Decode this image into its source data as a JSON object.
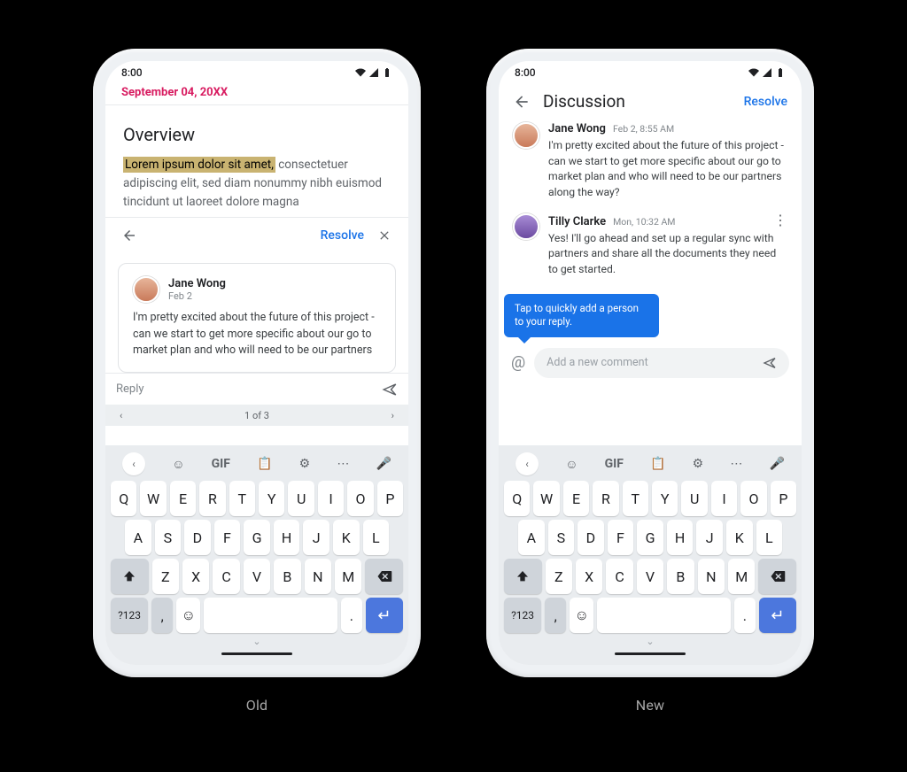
{
  "captions": {
    "left": "Old",
    "right": "New"
  },
  "status": {
    "time": "8:00"
  },
  "old": {
    "date": "September 04, 20XX",
    "heading": "Overview",
    "para_hl": "Lorem ipsum dolor sit amet,",
    "para_rest": " consectetuer adipiscing elit, sed diam nonummy nibh euismod tincidunt ut laoreet dolore magna",
    "resolve": "Resolve",
    "comment": {
      "name": "Jane Wong",
      "when": "Feb 2",
      "body": "I'm pretty excited about the future of this project - can we start to get more specific about our go to market plan and who will need to be our partners"
    },
    "reply_placeholder": "Reply",
    "pager": "1 of 3"
  },
  "new": {
    "title": "Discussion",
    "resolve": "Resolve",
    "thread": [
      {
        "name": "Jane Wong",
        "ts": "Feb 2, 8:55 AM",
        "txt": "I'm pretty excited about the future of this project - can we start to get more specific about our go to market plan and who will need to be our partners along the way?"
      },
      {
        "name": "Tilly Clarke",
        "ts": "Mon, 10:32 AM",
        "txt": "Yes! I'll go ahead and set up a regular sync with partners and share all the documents they need to get started."
      }
    ],
    "tooltip": "Tap to quickly add a person to your reply.",
    "compose_placeholder": "Add a new comment"
  },
  "keyboard": {
    "gif": "GIF",
    "row1": [
      "Q",
      "W",
      "E",
      "R",
      "T",
      "Y",
      "U",
      "I",
      "O",
      "P"
    ],
    "row2": [
      "A",
      "S",
      "D",
      "F",
      "G",
      "H",
      "J",
      "K",
      "L"
    ],
    "row3": [
      "Z",
      "X",
      "C",
      "V",
      "B",
      "N",
      "M"
    ],
    "sym": "?123",
    "comma": ",",
    "period": "."
  }
}
